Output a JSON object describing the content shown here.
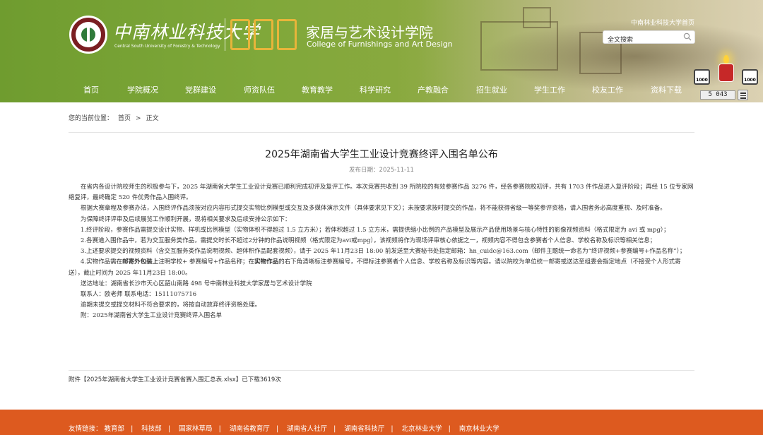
{
  "header": {
    "university_cn": "中南林业科技大学",
    "university_en": "Central South University of Forestry & Technology",
    "college_cn": "家居与艺术设计学院",
    "college_en": "College of Furnishings and Art Design",
    "home_link": "中南林业科技大学首页",
    "search_placeholder": "全文搜索",
    "visitor_count": "5 043",
    "badge_left": "1000",
    "badge_right": "1000"
  },
  "nav": {
    "items": [
      "首页",
      "学院概况",
      "党群建设",
      "师资队伍",
      "教育教学",
      "科学研究",
      "产教融合",
      "招生就业",
      "学生工作",
      "校友工作",
      "资料下载"
    ]
  },
  "breadcrumb": {
    "prefix": "您的当前位置：",
    "home": "首页",
    "separator": ">",
    "current": "正文"
  },
  "article": {
    "title": "2025年湖南省大学生工业设计竞赛终评入围名单公布",
    "date": "发布日期：2025-11-11",
    "p1": "在省内各设计院校师生的积极参与下，2025 年湖南省大学生工业设计竞赛已顺利完成初评及复评工作。本次竞赛共收到 39 所院校的有效参赛作品 3276 件，经各参赛院校初评，共有 1703 件作品进入复评阶段；再经 15 位专家网络复评，最终确定 520 件优秀作品入围终评。",
    "p2": "根据大赛章程及参赛办法，入围终评作品须按对应内容形式提交实物比例模型或交互及多媒体演示文件（具体要求见下文）；未按要求按时提交的作品，将不能获得省级一等奖参评资格，请入围者务必高度重视、及时准备。",
    "p3": "为保障终评评审及后续展览工作顺利开展，现将相关要求及后续安排公示如下：",
    "p4": "1.终评阶段，参赛作品需提交设计实物、样机或比例模型（实物体积不得超过 1.5 立方米）；若体积超过 1.5 立方米，需提供缩小比例的产品模型及展示产品使用场景与核心特性的影像视频资料（格式限定为 avi 或 mpg）；",
    "p5": "2.各赛道入围作品中，若为交互服务类作品，需提交时长不超过2分钟的作品说明视频（格式限定为avi或mpg），该视频将作为现场评审核心依据之一，视频内容不得包含参赛者个人信息、学校名称及标识等相关信息；",
    "p6": "3.上述要求提交的视频资料（含交互服务类作品说明视频、超体积作品配套视频），请于 2025 年11月23日 18:00 前发送至大赛秘书处指定邮箱：hn_cuidc@163.com（邮件主题统一命名为“终评视频+参赛编号+作品名称”）；",
    "p7_a": "4.实物作品需在",
    "p7_b": "邮寄外包装上",
    "p7_c": "注明学校+ 参赛编号+作品名称；在",
    "p7_d": "实物作品",
    "p7_e": "的右下角清晰标注参赛编号，不得标注参赛者个人信息、学校名称及标识等内容。请以院校为单位统一邮寄或送达至组委会指定地点（不接受个人形式寄送），截止时间为 2025 年11月23日 18:00。",
    "p8": "送达地址：湖南省长沙市天心区韶山南路 498 号中南林业科技大学家居与艺术设计学院",
    "p9": "联系人：欧老师 联系电话：15111075716",
    "p10": "逾期未提交或提交材料不符合要求的，将按自动放弃终评资格处理。",
    "p11": "附：2025年湖南省大学生工业设计竞赛终评入围名单",
    "attachment_prefix": "附件【",
    "attachment_name": "2025年湖南省大学生工业设计竞赛省赛入围汇总表.xlsx",
    "attachment_suffix": "】已下载3619次"
  },
  "footer": {
    "label": "友情链接：",
    "links": [
      "教育部",
      "科技部",
      "国家林草局",
      "湖南省教育厅",
      "湖南省人社厅",
      "湖南省科技厅",
      "北京林业大学",
      "南京林业大学"
    ]
  }
}
